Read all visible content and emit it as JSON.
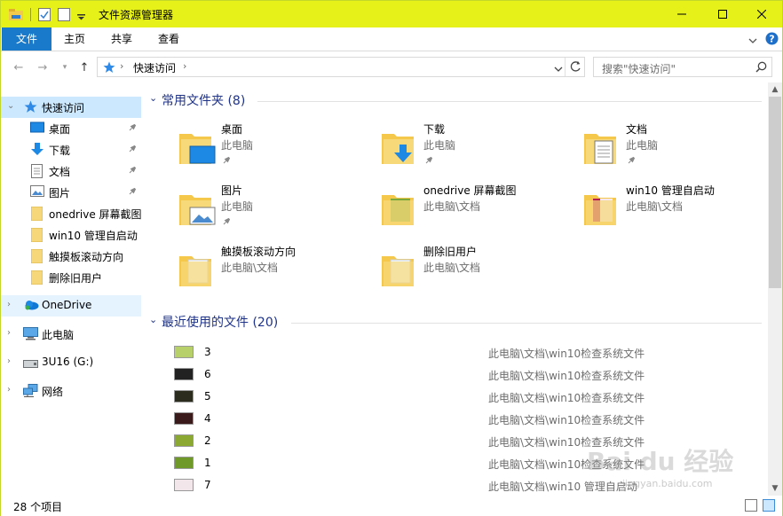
{
  "window": {
    "title": "文件资源管理器",
    "accent": "#e6f11a",
    "ribbon_blue": "#1979ca"
  },
  "ribbon": {
    "file": "文件",
    "tabs": [
      "主页",
      "共享",
      "查看"
    ]
  },
  "address": {
    "path": "快速访问",
    "search_placeholder": "搜索\"快速访问\""
  },
  "nav": {
    "quick_access": "快速访问",
    "pinned": [
      {
        "label": "桌面",
        "icon": "desktop-icon"
      },
      {
        "label": "下载",
        "icon": "download-icon"
      },
      {
        "label": "文档",
        "icon": "document-icon"
      },
      {
        "label": "图片",
        "icon": "picture-icon"
      }
    ],
    "recent_folders": [
      "onedrive 屏幕截图",
      "win10 管理自启动",
      "触摸板滚动方向",
      "删除旧用户"
    ],
    "roots": [
      {
        "label": "OneDrive",
        "icon": "onedrive-icon"
      },
      {
        "label": "此电脑",
        "icon": "computer-icon"
      },
      {
        "label": "3U16 (G:)",
        "icon": "usb-drive-icon"
      },
      {
        "label": "网络",
        "icon": "network-icon"
      }
    ]
  },
  "frequent": {
    "header": "常用文件夹 (8)",
    "items": [
      {
        "name": "桌面",
        "location": "此电脑",
        "pinned": true,
        "icon": "folder-desktop-icon"
      },
      {
        "name": "下载",
        "location": "此电脑",
        "pinned": true,
        "icon": "folder-download-icon"
      },
      {
        "name": "文档",
        "location": "此电脑",
        "pinned": true,
        "icon": "folder-document-icon"
      },
      {
        "name": "图片",
        "location": "此电脑",
        "pinned": true,
        "icon": "folder-picture-icon"
      },
      {
        "name": "onedrive 屏幕截图",
        "location": "此电脑\\文档",
        "pinned": false,
        "icon": "folder-icon"
      },
      {
        "name": "win10 管理自启动",
        "location": "此电脑\\文档",
        "pinned": false,
        "icon": "folder-icon"
      },
      {
        "name": "触摸板滚动方向",
        "location": "此电脑\\文档",
        "pinned": false,
        "icon": "folder-icon"
      },
      {
        "name": "删除旧用户",
        "location": "此电脑\\文档",
        "pinned": false,
        "icon": "folder-icon"
      }
    ]
  },
  "recent": {
    "header": "最近使用的文件 (20)",
    "items": [
      {
        "name": "3",
        "path": "此电脑\\文档\\win10检查系统文件",
        "thumb": "#b8d06a"
      },
      {
        "name": "6",
        "path": "此电脑\\文档\\win10检查系统文件",
        "thumb": "#222222"
      },
      {
        "name": "5",
        "path": "此电脑\\文档\\win10检查系统文件",
        "thumb": "#2b2b1e"
      },
      {
        "name": "4",
        "path": "此电脑\\文档\\win10检查系统文件",
        "thumb": "#3a1a1a"
      },
      {
        "name": "2",
        "path": "此电脑\\文档\\win10检查系统文件",
        "thumb": "#8aa832"
      },
      {
        "name": "1",
        "path": "此电脑\\文档\\win10检查系统文件",
        "thumb": "#6f9a2a"
      },
      {
        "name": "7",
        "path": "此电脑\\文档\\win10 管理自启动",
        "thumb": "#f2e6ea"
      }
    ]
  },
  "status": {
    "count": "28 个项目"
  },
  "watermark": {
    "text": "Bai du 经验",
    "sub": "jingyan.baidu.com"
  }
}
